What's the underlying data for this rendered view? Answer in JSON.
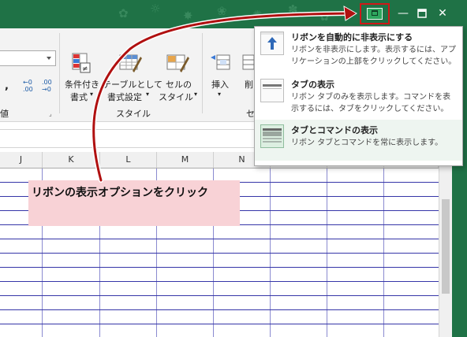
{
  "ribbon": {
    "number_format_value": "",
    "comma_symbol": ",",
    "decimal_increase": "←0\n.00",
    "decimal_decrease": ".00\n→0",
    "numeric_group_label_partial": "値",
    "conditional_format": {
      "line1": "条件付き",
      "line2": "書式"
    },
    "format_as_table": {
      "line1": "テーブルとして",
      "line2": "書式設定"
    },
    "cell_styles": {
      "line1": "セルの",
      "line2": "スタイル"
    },
    "styles_group_label": "スタイル",
    "insert": {
      "line1": "挿入"
    },
    "delete_partial": {
      "line1": "削"
    },
    "cells_group_label_partial": "セ"
  },
  "grid": {
    "columns": [
      "J",
      "K",
      "L",
      "M",
      "N"
    ]
  },
  "ribbon_display_options": {
    "options": [
      {
        "icon": "arrow-up-icon",
        "title": "リボンを自動的に非表示にする",
        "description": "リボンを非表示にします。表示するには、アプリケーションの上部をクリックしてください。"
      },
      {
        "icon": "tabs-only-icon",
        "title": "タブの表示",
        "description": "リボン タブのみを表示します。コマンドを表示するには、タブをクリックしてください。"
      },
      {
        "icon": "tabs-and-commands-icon",
        "title": "タブとコマンドの表示",
        "description": "リボン タブとコマンドを常に表示します。"
      }
    ]
  },
  "callout": {
    "text": "リボンの表示オプションをクリック"
  },
  "colors": {
    "titlebar": "#1f7246",
    "highlight_border": "#d01818",
    "arrow": "#b01010",
    "callout_bg": "#f8d2d6"
  }
}
